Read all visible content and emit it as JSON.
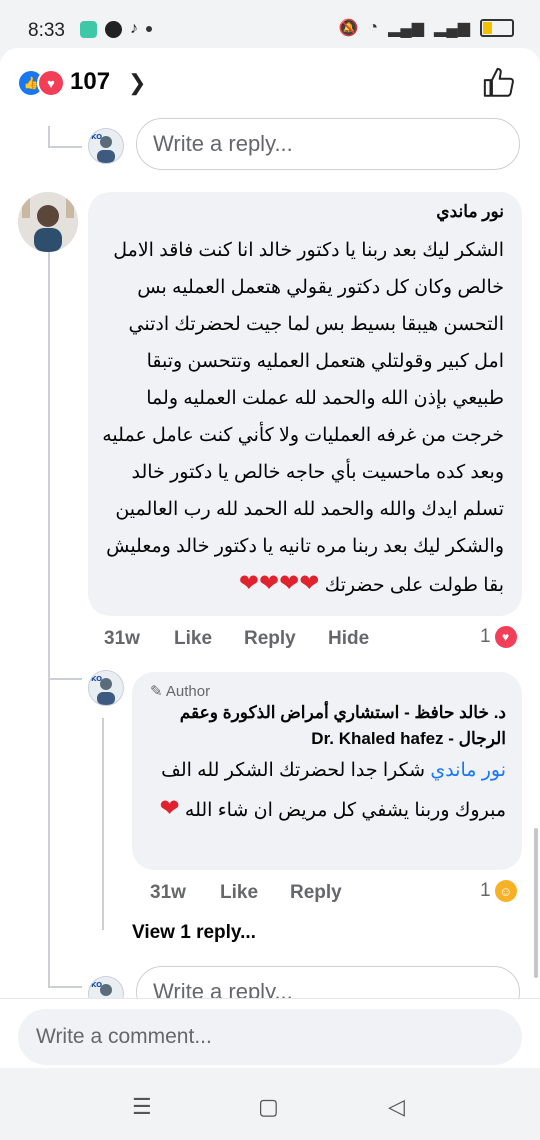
{
  "status_bar": {
    "time": "8:33"
  },
  "reactions": {
    "count": "107"
  },
  "reply_box_top": {
    "placeholder": "Write a reply..."
  },
  "comment1": {
    "author": "نور ماندي",
    "text": "الشكر ليك بعد ربنا يا دكتور خالد انا كنت فاقد الامل خالص وكان كل دكتور يقولي هتعمل العمليه بس التحسن هيبقا بسيط بس لما جيت لحضرتك ادتني امل كبير وقولتلي هتعمل العمليه وتتحسن وتبقا طبيعي بإذن الله والحمد لله عملت العمليه ولما خرجت من غرفه العمليات ولا كأني كنت عامل عمليه وبعد كده ماحسيت بأي حاجه خالص يا دكتور خالد تسلم ايدك والله والحمد لله الحمد لله رب العالمين والشكر ليك بعد ربنا مره تانيه يا دكتور خالد ومعليش بقا طولت على حضرتك",
    "hearts": "❤❤❤❤",
    "time": "31w",
    "like": "Like",
    "reply": "Reply",
    "hide": "Hide",
    "like_count": "1"
  },
  "comment2": {
    "author_badge": "Author",
    "author": "د. خالد حافظ  - استشاري أمراض الذكورة وعقم الرجال - Dr. Khaled hafez",
    "mention": "نور ماندي",
    "text": " شكرا جدا لحضرتك الشكر لله الف مبروك وربنا يشفي كل مريض ان شاء الله",
    "heart": "❤",
    "time": "31w",
    "like": "Like",
    "reply": "Reply",
    "like_count": "1"
  },
  "view_replies": "View 1 reply...",
  "reply_box_bottom": {
    "placeholder": "Write a reply..."
  },
  "comment_input": {
    "placeholder": "Write a comment..."
  }
}
